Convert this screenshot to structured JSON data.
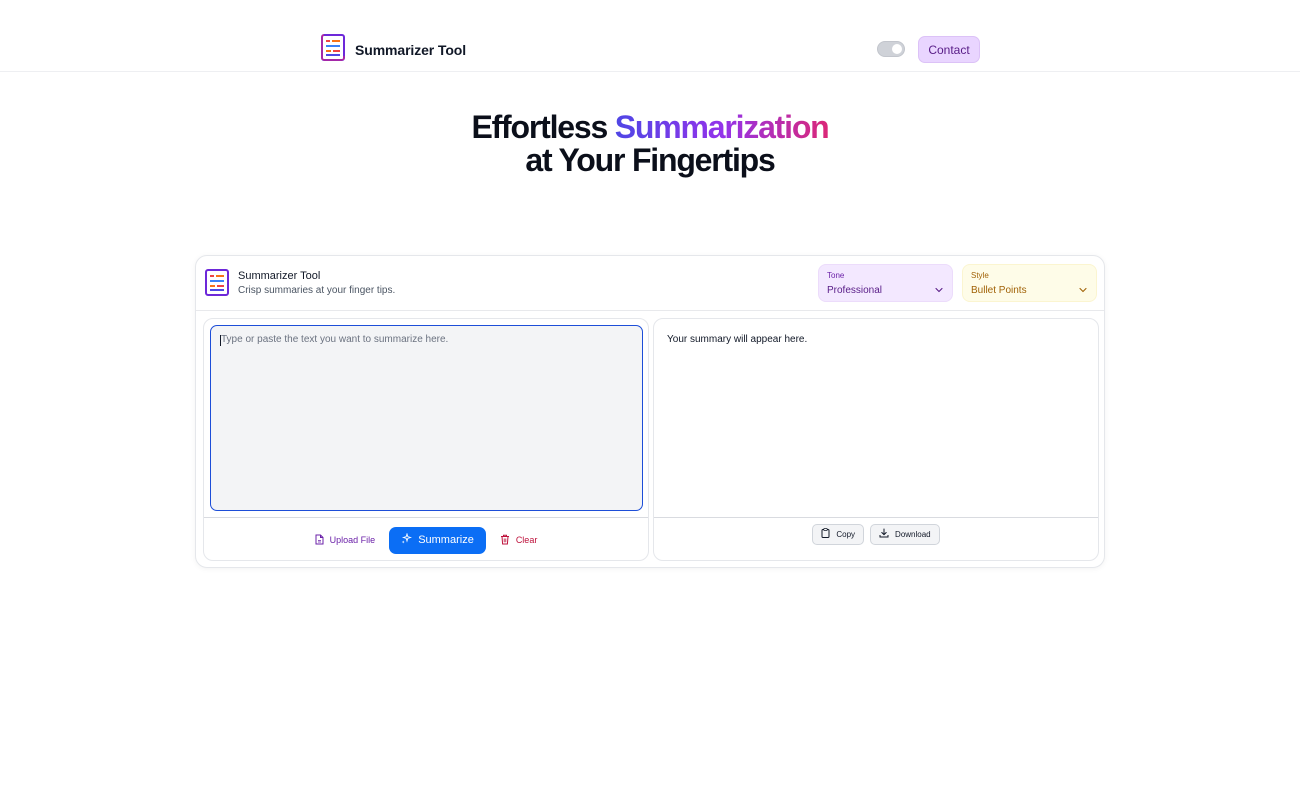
{
  "nav": {
    "brand": "Summarizer Tool",
    "contact_label": "Contact"
  },
  "hero": {
    "line1_plain": "Effortless ",
    "line1_highlight": "Summarization",
    "line2": "at Your Fingertips"
  },
  "card": {
    "title": "Summarizer Tool",
    "subtitle": "Crisp summaries at your finger tips.",
    "tone": {
      "label": "Tone",
      "value": "Professional"
    },
    "style": {
      "label": "Style",
      "value": "Bullet Points"
    }
  },
  "input": {
    "placeholder": "Type or paste the text you want to summarize here.",
    "value": ""
  },
  "actions": {
    "upload_label": "Upload File",
    "summarize_label": "Summarize",
    "clear_label": "Clear"
  },
  "output": {
    "placeholder_text": "Your summary will appear here.",
    "copy_label": "Copy",
    "download_label": "Download"
  },
  "colors": {
    "accent_blue": "#0b6ef5",
    "contact_bg": "#e9d5ff",
    "tone_bg": "#f3e8ff",
    "style_bg": "#fefce8",
    "clear_red": "#be123c",
    "upload_purple": "#6b21a8"
  },
  "icons": {
    "brand": "summary-list-icon",
    "upload": "file-icon",
    "summarize": "sparkles-icon",
    "clear": "trash-icon",
    "copy": "clipboard-icon",
    "download": "download-icon",
    "select": "chevron-down-icon"
  }
}
